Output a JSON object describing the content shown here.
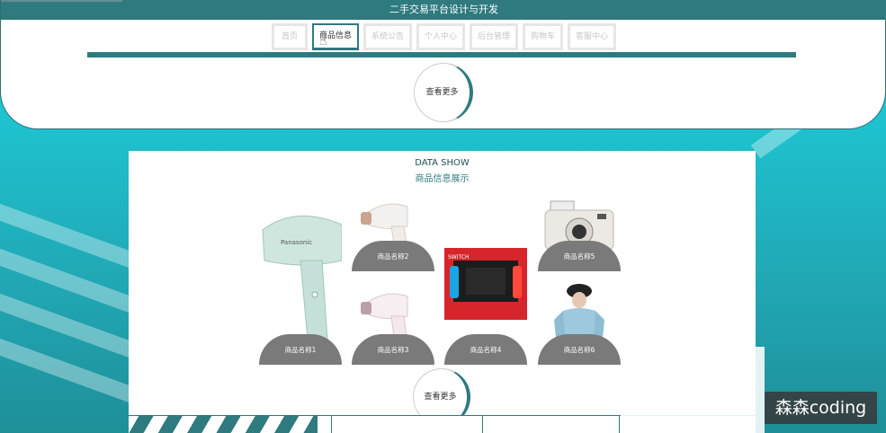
{
  "header": {
    "title": "二手交易平台设计与开发",
    "nav": [
      "首页",
      "商品信息",
      "系统公告",
      "个人中心",
      "后台管理",
      "购物车",
      "客服中心"
    ],
    "active_index": 1,
    "more_label": "查看更多"
  },
  "section": {
    "title_en": "DATA SHOW",
    "title_cn": "商品信息展示",
    "products": [
      {
        "name": "商品名称1",
        "icon": "hair-dryer"
      },
      {
        "name": "商品名称2",
        "icon": "hair-dryer"
      },
      {
        "name": "商品名称3",
        "icon": "hair-dryer"
      },
      {
        "name": "商品名称4",
        "icon": "game-console"
      },
      {
        "name": "商品名称5",
        "icon": "instant-camera"
      },
      {
        "name": "商品名称6",
        "icon": "hoodie-person"
      }
    ],
    "more_label": "查看更多"
  },
  "watermark": "森森coding",
  "colors": {
    "accent": "#2e7a7f",
    "teal": "#1ec7d4",
    "caption": "#7a7a7a"
  }
}
